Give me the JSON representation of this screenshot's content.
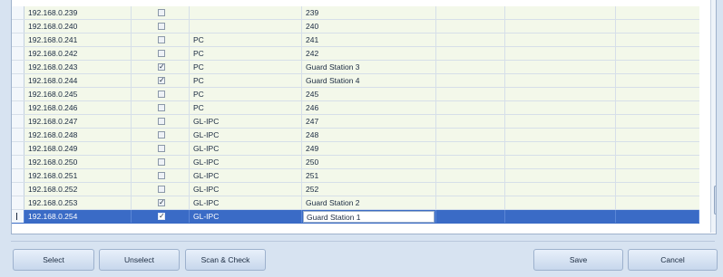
{
  "grid": {
    "rows": [
      {
        "ip": "192.168.0.239",
        "checked": false,
        "type": "",
        "name": "239"
      },
      {
        "ip": "192.168.0.240",
        "checked": false,
        "type": "",
        "name": "240"
      },
      {
        "ip": "192.168.0.241",
        "checked": false,
        "type": "PC",
        "name": "241"
      },
      {
        "ip": "192.168.0.242",
        "checked": false,
        "type": "PC",
        "name": "242"
      },
      {
        "ip": "192.168.0.243",
        "checked": true,
        "type": "PC",
        "name": "Guard Station 3"
      },
      {
        "ip": "192.168.0.244",
        "checked": true,
        "type": "PC",
        "name": "Guard Station 4"
      },
      {
        "ip": "192.168.0.245",
        "checked": false,
        "type": "PC",
        "name": "245"
      },
      {
        "ip": "192.168.0.246",
        "checked": false,
        "type": "PC",
        "name": "246"
      },
      {
        "ip": "192.168.0.247",
        "checked": false,
        "type": "GL-IPC",
        "name": "247"
      },
      {
        "ip": "192.168.0.248",
        "checked": false,
        "type": "GL-IPC",
        "name": "248"
      },
      {
        "ip": "192.168.0.249",
        "checked": false,
        "type": "GL-IPC",
        "name": "249"
      },
      {
        "ip": "192.168.0.250",
        "checked": false,
        "type": "GL-IPC",
        "name": "250"
      },
      {
        "ip": "192.168.0.251",
        "checked": false,
        "type": "GL-IPC",
        "name": "251"
      },
      {
        "ip": "192.168.0.252",
        "checked": false,
        "type": "GL-IPC",
        "name": "252"
      },
      {
        "ip": "192.168.0.253",
        "checked": true,
        "type": "GL-IPC",
        "name": "Guard Station 2"
      },
      {
        "ip": "192.168.0.254",
        "checked": true,
        "type": "GL-IPC",
        "name": "Guard Station 1",
        "selected": true,
        "editing": true
      }
    ]
  },
  "buttons": {
    "select": "Select",
    "unselect": "Unselect",
    "scan_check": "Scan & Check",
    "save": "Save",
    "cancel": "Cancel"
  },
  "icons": {
    "checkmark": "✓",
    "scroll_down": "▼"
  },
  "colors": {
    "row_background": "#f3f8ea",
    "selected_row": "#3a6bc6",
    "window_background": "#d7e3f1"
  }
}
